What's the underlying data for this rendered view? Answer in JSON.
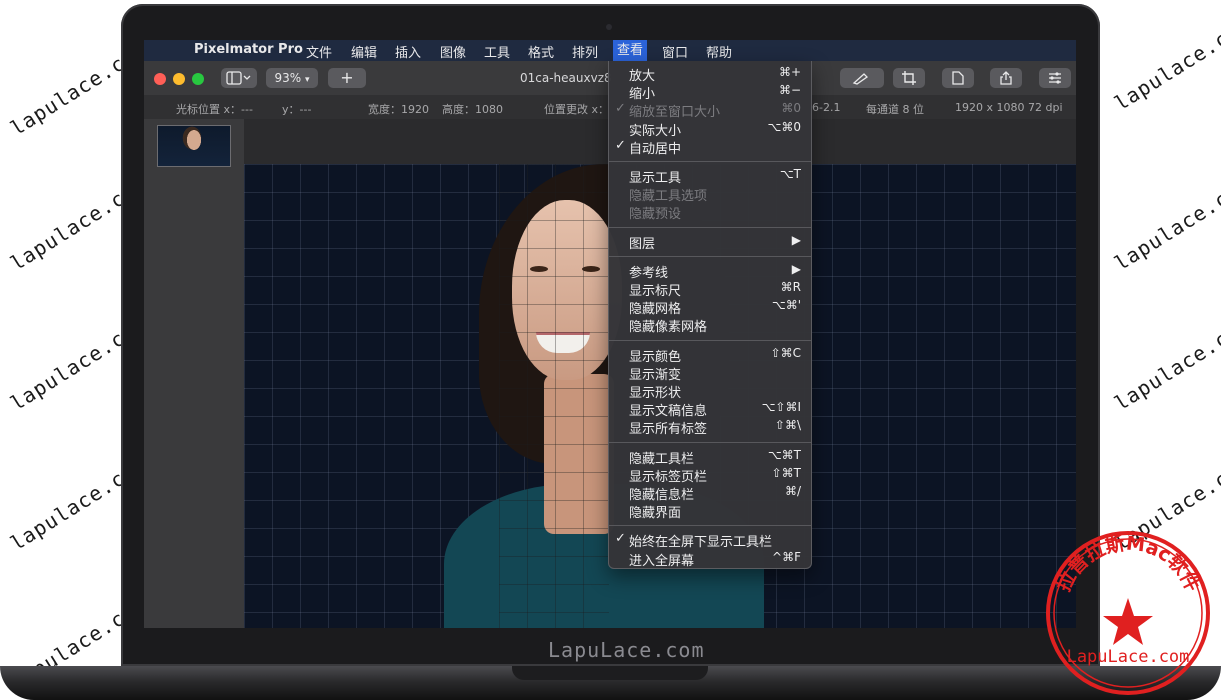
{
  "watermark": "lapulace.com",
  "brand": "LapuLace.com",
  "menubar": {
    "app_name": "Pixelmator Pro",
    "items": [
      "文件",
      "编辑",
      "插入",
      "图像",
      "工具",
      "格式",
      "排列",
      "查看",
      "窗口",
      "帮助"
    ],
    "active_item": "查看"
  },
  "toolbar": {
    "zoom_label": "93%",
    "add_label": "+",
    "doc_title": "01ca-heauxvz8"
  },
  "infobar": {
    "cursor_x": "光标位置 x：---",
    "cursor_y": "y：---",
    "width": "宽度：1920",
    "height": "高度：1080",
    "pos_change": "位置更改 x：",
    "color_profile": "6-2.1",
    "bits": "每通道 8 位",
    "size_dpi": "1920 x 1080 72 dpi"
  },
  "view_menu": {
    "groups": [
      [
        {
          "label": "放大",
          "shortcut": "⌘+",
          "checked": false,
          "disabled": false,
          "submenu": false
        },
        {
          "label": "缩小",
          "shortcut": "⌘−",
          "checked": false,
          "disabled": false,
          "submenu": false
        },
        {
          "label": "缩放至窗口大小",
          "shortcut": "⌘0",
          "checked": true,
          "disabled": true,
          "submenu": false
        },
        {
          "label": "实际大小",
          "shortcut": "⌥⌘0",
          "checked": false,
          "disabled": false,
          "submenu": false
        },
        {
          "label": "自动居中",
          "shortcut": "",
          "checked": true,
          "disabled": false,
          "submenu": false
        }
      ],
      [
        {
          "label": "显示工具",
          "shortcut": "⌥T",
          "checked": false,
          "disabled": false,
          "submenu": false
        },
        {
          "label": "隐藏工具选项",
          "shortcut": "",
          "checked": false,
          "disabled": true,
          "submenu": false
        },
        {
          "label": "隐藏预设",
          "shortcut": "",
          "checked": false,
          "disabled": true,
          "submenu": false
        }
      ],
      [
        {
          "label": "图层",
          "shortcut": "▶",
          "checked": false,
          "disabled": false,
          "submenu": true
        }
      ],
      [
        {
          "label": "参考线",
          "shortcut": "▶",
          "checked": false,
          "disabled": false,
          "submenu": true
        },
        {
          "label": "显示标尺",
          "shortcut": "⌘R",
          "checked": false,
          "disabled": false,
          "submenu": false
        },
        {
          "label": "隐藏网格",
          "shortcut": "⌥⌘'",
          "checked": false,
          "disabled": false,
          "submenu": false
        },
        {
          "label": "隐藏像素网格",
          "shortcut": "",
          "checked": false,
          "disabled": false,
          "submenu": false
        }
      ],
      [
        {
          "label": "显示颜色",
          "shortcut": "⇧⌘C",
          "checked": false,
          "disabled": false,
          "submenu": false
        },
        {
          "label": "显示渐变",
          "shortcut": "",
          "checked": false,
          "disabled": false,
          "submenu": false
        },
        {
          "label": "显示形状",
          "shortcut": "",
          "checked": false,
          "disabled": false,
          "submenu": false
        },
        {
          "label": "显示文稿信息",
          "shortcut": "⌥⇧⌘I",
          "checked": false,
          "disabled": false,
          "submenu": false
        },
        {
          "label": "显示所有标签",
          "shortcut": "⇧⌘\\",
          "checked": false,
          "disabled": false,
          "submenu": false
        }
      ],
      [
        {
          "label": "隐藏工具栏",
          "shortcut": "⌥⌘T",
          "checked": false,
          "disabled": false,
          "submenu": false
        },
        {
          "label": "显示标签页栏",
          "shortcut": "⇧⌘T",
          "checked": false,
          "disabled": false,
          "submenu": false
        },
        {
          "label": "隐藏信息栏",
          "shortcut": "⌘/",
          "checked": false,
          "disabled": false,
          "submenu": false
        },
        {
          "label": "隐藏界面",
          "shortcut": "",
          "checked": false,
          "disabled": false,
          "submenu": false
        }
      ],
      [
        {
          "label": "始终在全屏下显示工具栏",
          "shortcut": "",
          "checked": true,
          "disabled": false,
          "submenu": false
        },
        {
          "label": "进入全屏幕",
          "shortcut": "^⌘F",
          "checked": false,
          "disabled": false,
          "submenu": false
        }
      ]
    ]
  },
  "stamp": {
    "arc_text": "拉普拉斯Mac软件",
    "url_text": "LapuLace.com"
  },
  "colors": {
    "menubar_bg": "#1f2a40",
    "menu_highlight": "#2b63d9",
    "close": "#ff5f57",
    "minimize": "#febc2e",
    "zoom": "#28c840",
    "stamp_red": "#e02020"
  }
}
